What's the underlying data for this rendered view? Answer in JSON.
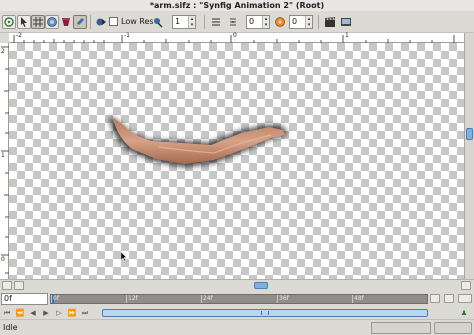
{
  "window": {
    "title": "*arm.sifz : \"Synfig Animation 2\" (Root)"
  },
  "toolbar": {
    "lowres_label": "Low Res",
    "lowres_checked": false,
    "spin1_value": "1",
    "spin2_value": "0",
    "spin3_value": "0"
  },
  "rulers": {
    "top_labels": [
      "-2",
      "-1",
      "0",
      "1"
    ],
    "left_labels": [
      "2",
      "1",
      "0"
    ]
  },
  "timebar": {
    "current_frame": "0f",
    "ticks": [
      "0f",
      "12f",
      "24f",
      "36f",
      "48f"
    ]
  },
  "status": {
    "text": "Idle"
  },
  "colors": {
    "accent": "#7fb0e0",
    "skin": "#c98c6e"
  }
}
